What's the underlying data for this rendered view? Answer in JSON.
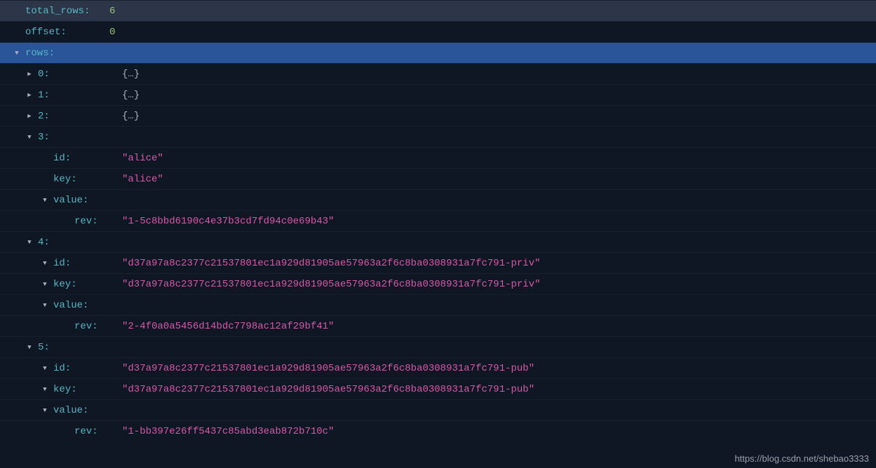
{
  "json": {
    "total_rows": {
      "key": "total_rows:",
      "value": "6"
    },
    "offset": {
      "key": "offset:",
      "value": "0"
    },
    "rows_key": "rows:",
    "rows": [
      {
        "idx_key": "0:",
        "expanded": false,
        "placeholder": "{…}"
      },
      {
        "idx_key": "1:",
        "expanded": false,
        "placeholder": "{…}"
      },
      {
        "idx_key": "2:",
        "expanded": false,
        "placeholder": "{…}"
      },
      {
        "idx_key": "3:",
        "expanded": true,
        "id_key": "id:",
        "id_value": "\"alice\"",
        "id_toggle": false,
        "key_key": "key:",
        "key_value": "\"alice\"",
        "key_toggle": false,
        "value_key": "value:",
        "rev_key": "rev:",
        "rev_value": "\"1-5c8bbd6190c4e37b3cd7fd94c0e69b43\""
      },
      {
        "idx_key": "4:",
        "expanded": true,
        "id_key": "id:",
        "id_value": "\"d37a97a8c2377c21537801ec1a929d81905ae57963a2f6c8ba0308931a7fc791-priv\"",
        "id_toggle": true,
        "key_key": "key:",
        "key_value": "\"d37a97a8c2377c21537801ec1a929d81905ae57963a2f6c8ba0308931a7fc791-priv\"",
        "key_toggle": true,
        "value_key": "value:",
        "rev_key": "rev:",
        "rev_value": "\"2-4f0a0a5456d14bdc7798ac12af29bf41\""
      },
      {
        "idx_key": "5:",
        "expanded": true,
        "id_key": "id:",
        "id_value": "\"d37a97a8c2377c21537801ec1a929d81905ae57963a2f6c8ba0308931a7fc791-pub\"",
        "id_toggle": true,
        "key_key": "key:",
        "key_value": "\"d37a97a8c2377c21537801ec1a929d81905ae57963a2f6c8ba0308931a7fc791-pub\"",
        "key_toggle": true,
        "value_key": "value:",
        "rev_key": "rev:",
        "rev_value": "\"1-bb397e26ff5437c85abd3eab872b710c\""
      }
    ]
  },
  "watermark": "https://blog.csdn.net/shebao3333"
}
